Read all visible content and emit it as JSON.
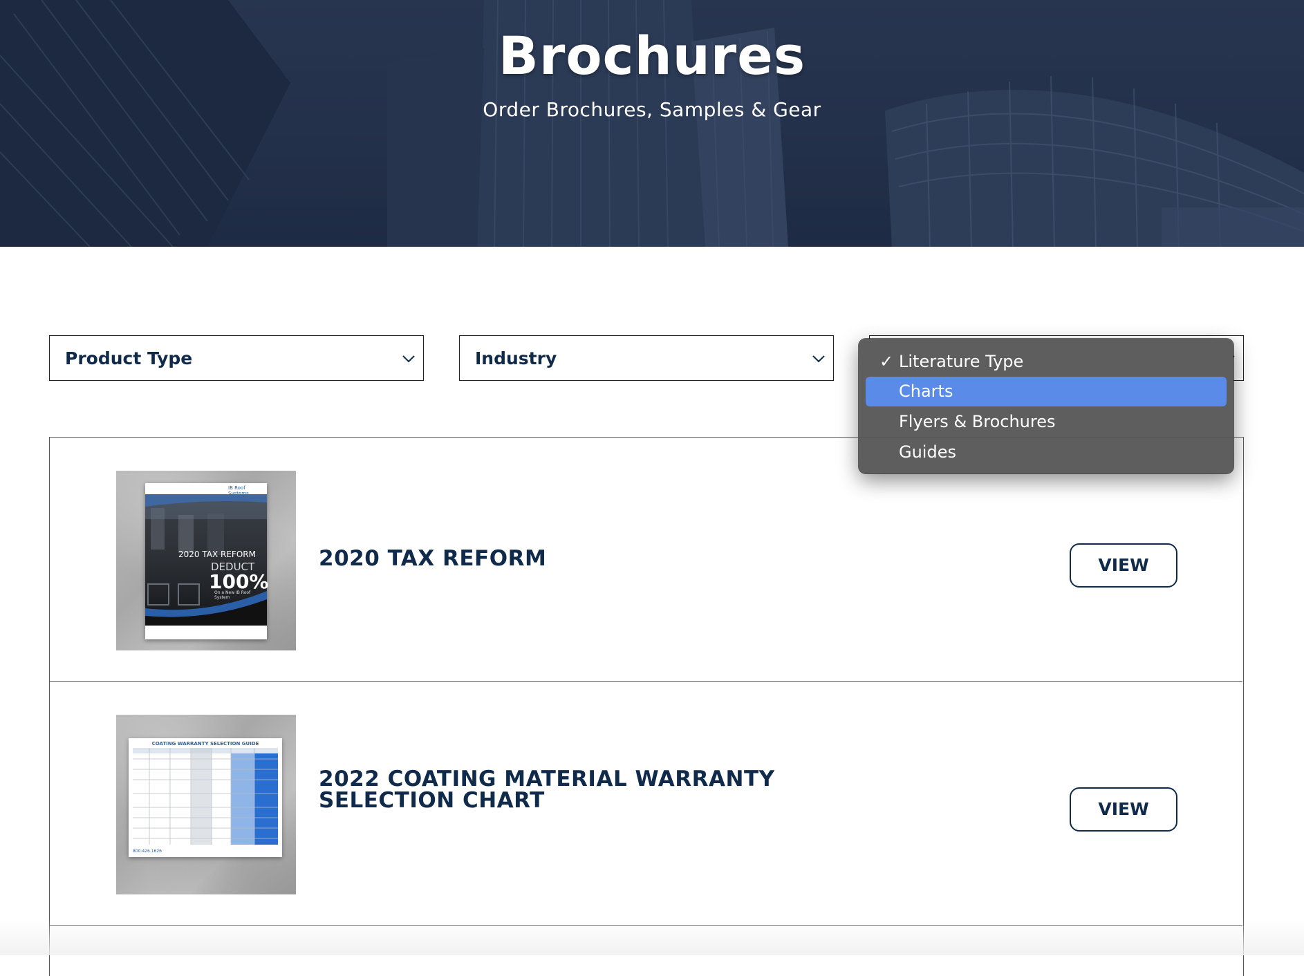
{
  "hero": {
    "title": "Brochures",
    "subtitle": "Order Brochures, Samples & Gear"
  },
  "filters": {
    "product_type": "Product Type",
    "industry": "Industry",
    "literature_type": "Literature Type"
  },
  "dropdown": {
    "check_mark": "✓",
    "options": [
      "Literature Type",
      "Charts",
      "Flyers & Brochures",
      "Guides"
    ],
    "checked_option": "Literature Type",
    "highlighted_option": "Charts"
  },
  "items": [
    {
      "title": "2020 TAX REFORM",
      "view_label": "VIEW",
      "thumb": {
        "logo": "IB Roof Systems",
        "line1": "2020 TAX REFORM",
        "line2": "DEDUCT",
        "line3": "100%",
        "line4": "On a New IB Roof System"
      }
    },
    {
      "title": "2022 COATING MATERIAL WARRANTY SELECTION CHART",
      "view_label": "VIEW",
      "thumb": {
        "heading": "COATING WARRANTY SELECTION GUIDE",
        "phone": "800.426.1626"
      }
    }
  ],
  "colors": {
    "brand_navy": "#0f2a4a",
    "dropdown_bg": "#5e5e5e",
    "dropdown_highlight": "#5a8be8"
  }
}
